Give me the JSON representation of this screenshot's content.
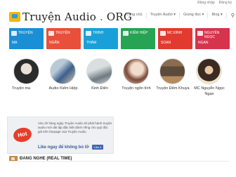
{
  "top_links": [
    "Đăng nhập",
    "Đăng ký"
  ],
  "logo": {
    "part1": "Truyện",
    "part2": "Audio",
    "dot": ".",
    "part3": "ORG"
  },
  "nav": [
    "Trang chủ",
    "Truyện Audio ▾",
    "Giọng đọc ▾",
    "Blog ▾"
  ],
  "nav_search_icon": "search-icon",
  "categories": [
    {
      "l1": "TRUYỆN",
      "l2": "MA",
      "color": "#1a8fd6"
    },
    {
      "l1": "TRUYỆN",
      "l2": "NGẮN",
      "color": "#e8503c"
    },
    {
      "l1": "TRINH",
      "l2": "THÁM",
      "color": "#1aa0d8"
    },
    {
      "l1": "KIẾM HIỆP",
      "l2": "",
      "color": "#26a353"
    },
    {
      "l1": "MC ĐÌNH",
      "l2": "SOẠN",
      "color": "#e23a2e"
    },
    {
      "l1": "NGUYỄN NGỌC",
      "l2": "NGẠN",
      "color": "#d6334c"
    }
  ],
  "authors": [
    {
      "name": "Truyện ma",
      "colors": [
        "#2b2b2b",
        "#e9e1d8"
      ]
    },
    {
      "name": "Audio Kiếm Hiệp",
      "colors": [
        "#3c5f8a",
        "#b8c9d8"
      ]
    },
    {
      "name": "Kinh Điển",
      "colors": [
        "#cfd6d8",
        "#6d7a80"
      ]
    },
    {
      "name": "Truyện ngôn tình",
      "colors": [
        "#e4c7b4",
        "#7a4b3a"
      ]
    },
    {
      "name": "Truyện Đêm Khuya",
      "colors": [
        "#5c4a3a",
        "#b58b5e"
      ]
    },
    {
      "name": "MC Nguyễn Ngọc Ngạn",
      "colors": [
        "#f1e4c9",
        "#3a2a22"
      ]
    }
  ],
  "promo": {
    "hot": "Hot",
    "text": "Vào 2h hàng ngày Truyện Audio sẽ phát hành truyện audio mới dài tập đặc biệt dành riêng cho quý độc giả trên fanpage của Truyện Audio.",
    "like_text": "Like ngay để không bỏ lỡ",
    "like_button": "Like 4"
  },
  "section": {
    "title": "ĐANG NGHE (REAL TIME)"
  }
}
